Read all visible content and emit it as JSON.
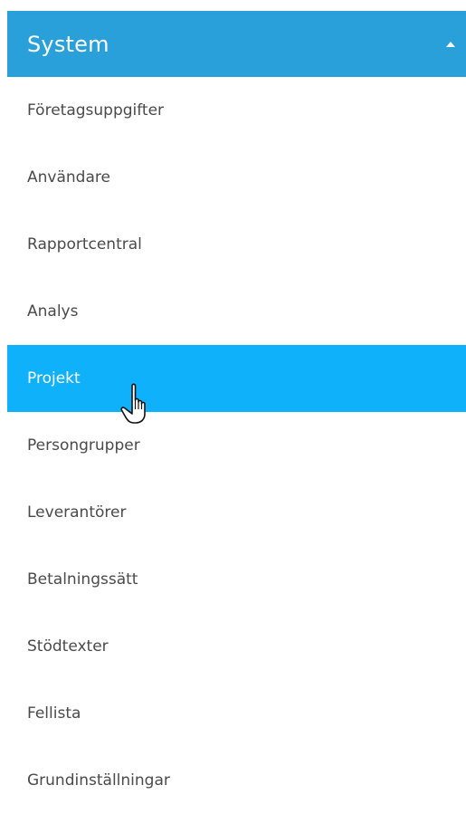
{
  "menu": {
    "title": "System",
    "expanded": true,
    "header_color": "#2aa0da",
    "active_color": "#0fb1fb",
    "collapse_icon": "caret-up-icon",
    "items": [
      {
        "label": "Företagsuppgifter",
        "active": false
      },
      {
        "label": "Användare",
        "active": false
      },
      {
        "label": "Rapportcentral",
        "active": false
      },
      {
        "label": "Analys",
        "active": false
      },
      {
        "label": "Projekt",
        "active": true
      },
      {
        "label": "Persongrupper",
        "active": false
      },
      {
        "label": "Leverantörer",
        "active": false
      },
      {
        "label": "Betalningssätt",
        "active": false
      },
      {
        "label": "Stödtexter",
        "active": false
      },
      {
        "label": "Fellista",
        "active": false
      },
      {
        "label": "Grundinställningar",
        "active": false
      }
    ]
  },
  "cursor": {
    "icon": "hand-pointer-icon"
  }
}
